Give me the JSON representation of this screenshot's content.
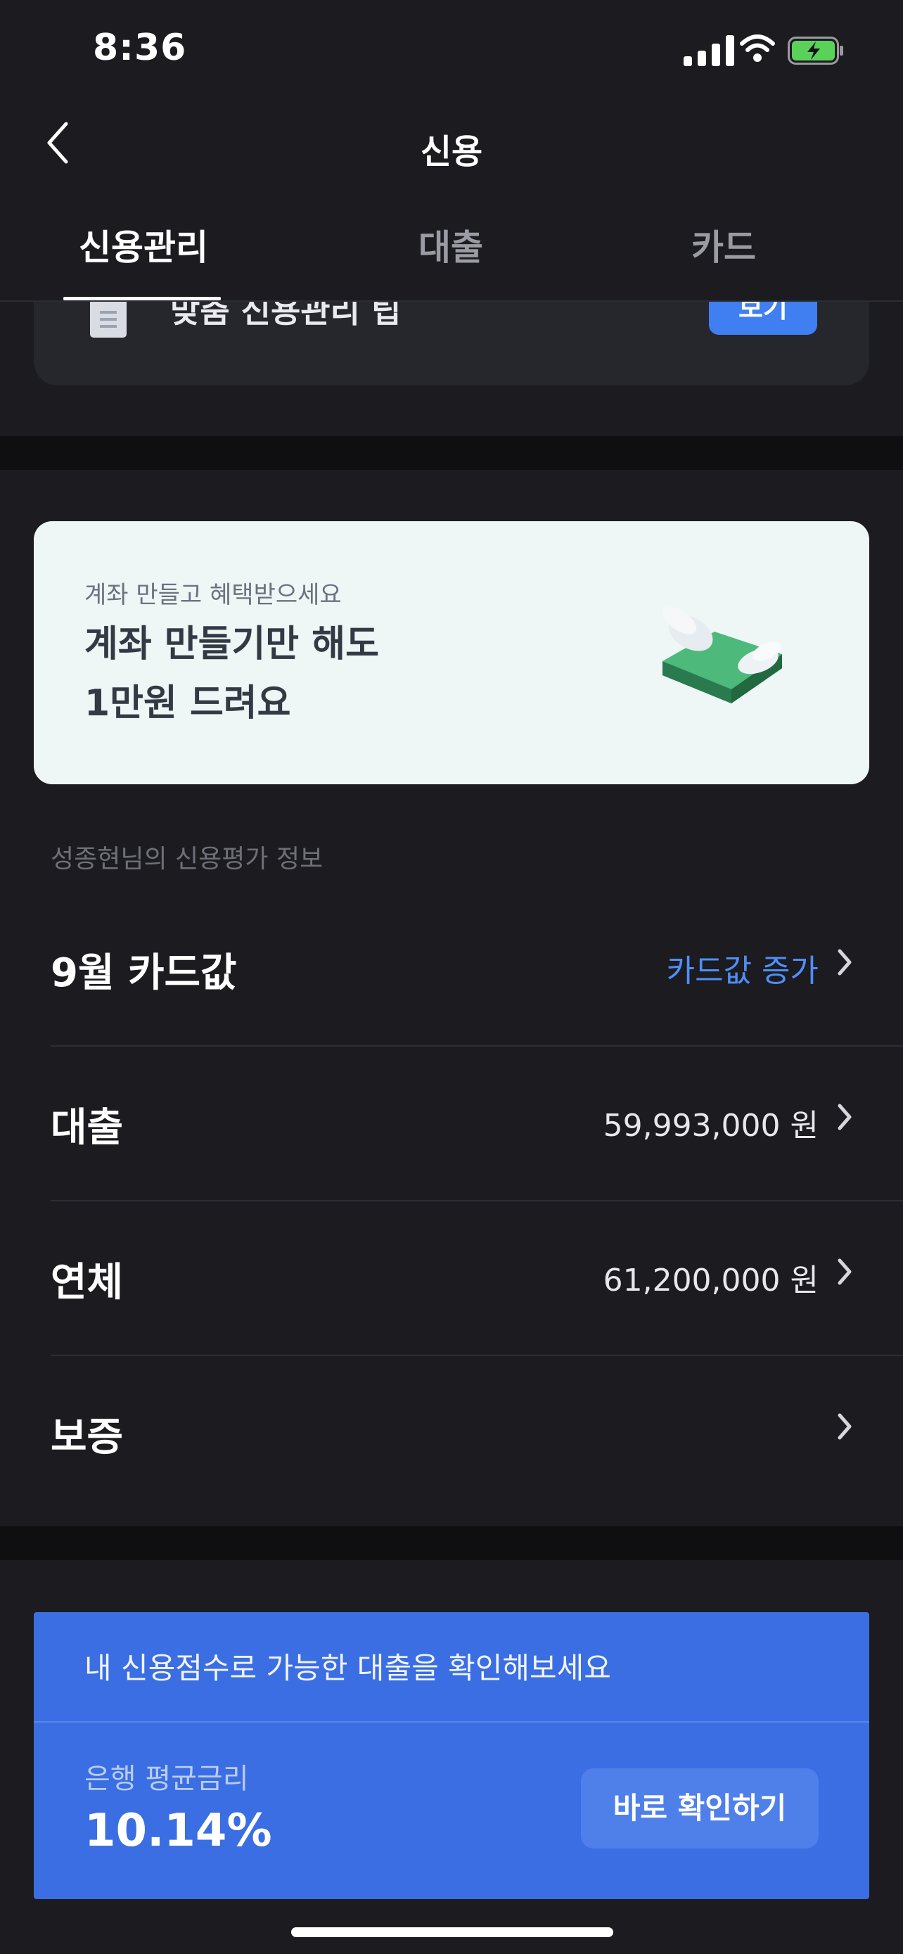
{
  "status_bar": {
    "time": "8:36"
  },
  "header": {
    "title": "신용"
  },
  "tabs": [
    {
      "label": "신용관리",
      "active": true
    },
    {
      "label": "대출",
      "active": false
    },
    {
      "label": "카드",
      "active": false
    }
  ],
  "tip_card": {
    "text": "맞춤 신용관리 팁",
    "button": "보기"
  },
  "promo": {
    "subtitle": "계좌 만들고 혜택받으세요",
    "line1": "계좌 만들기만 해도",
    "line2": "1만원 드려요"
  },
  "credit_info": {
    "section_label": "성종현님의 신용평가 정보",
    "rows": [
      {
        "label": "9월 카드값",
        "value": "카드값 증가",
        "value_color": "#4f8ff7"
      },
      {
        "label": "대출",
        "value": "59,993,000 원"
      },
      {
        "label": "연체",
        "value": "61,200,000 원"
      },
      {
        "label": "보증",
        "value": ""
      }
    ]
  },
  "loan_banner": {
    "headline": "내 신용점수로 가능한 대출을 확인해보세요",
    "rate_label": "은행 평균금리",
    "rate_value": "10.14%",
    "button": "바로 확인하기"
  },
  "colors": {
    "accent": "#3a6ee2",
    "background": "#1b1b20",
    "link_blue": "#4f8ff7"
  }
}
